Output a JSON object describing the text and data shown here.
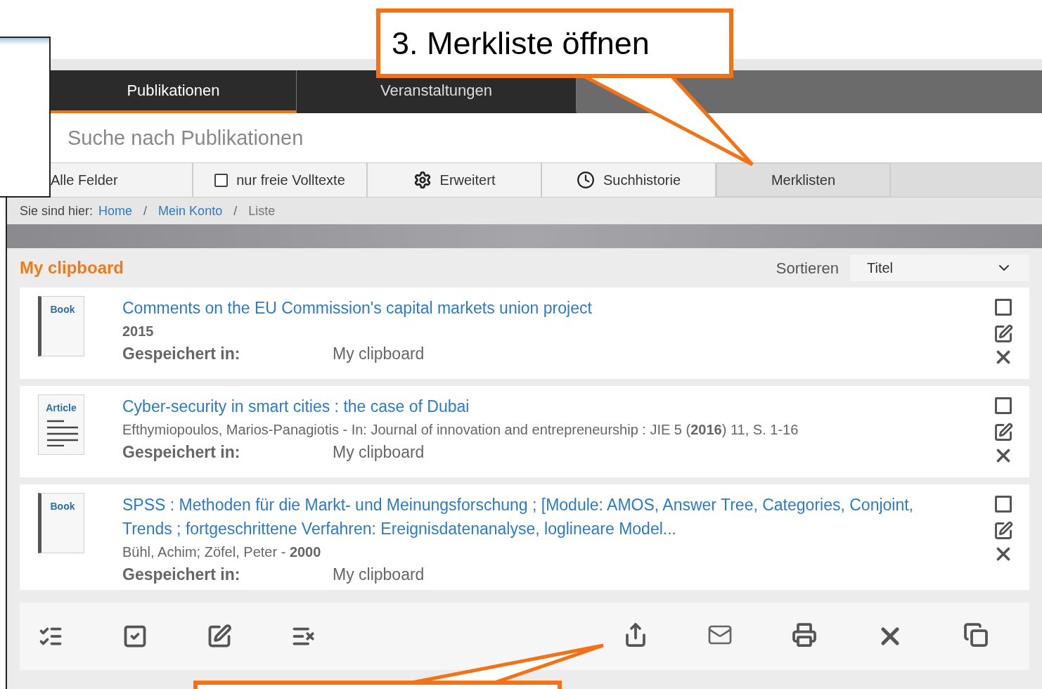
{
  "callouts": [
    {
      "text": "3. Merkliste öffnen"
    }
  ],
  "tabs": [
    {
      "label": "Publikationen",
      "selected": true
    },
    {
      "label": "Veranstaltungen",
      "selected": false
    }
  ],
  "search": {
    "placeholder": "Suche nach Publikationen"
  },
  "search_options": [
    {
      "kind": "select",
      "label": "Alle Felder",
      "selected": false
    },
    {
      "kind": "checkbox",
      "label": "nur freie Volltexte",
      "checked": false,
      "selected": false
    },
    {
      "kind": "gear",
      "label": "Erweitert",
      "selected": false
    },
    {
      "kind": "clock",
      "label": "Suchhistorie",
      "selected": false
    },
    {
      "kind": "plain",
      "label": "Merklisten",
      "selected": true
    }
  ],
  "breadcrumb": {
    "prefix": "Sie sind hier:",
    "items": [
      {
        "label": "Home",
        "kind": "link"
      },
      {
        "label": "Mein Konto",
        "kind": "link"
      },
      {
        "label": "Liste",
        "kind": "current"
      }
    ],
    "separator": "/"
  },
  "list": {
    "title": "My clipboard",
    "sort_label": "Sortieren",
    "sort_value": "Titel"
  },
  "entries": [
    {
      "kind": "book",
      "cover_label": "Book",
      "title": "Comments on the EU Commission's capital markets union project",
      "meta": "**2015**",
      "saved_label": "Gespeichert in:",
      "saved_value": "My clipboard",
      "checked": false
    },
    {
      "kind": "article",
      "cover_label": "Article",
      "title": "Cyber-security in smart cities : the case of Dubai",
      "meta": "Efthymiopoulos, Marios-Panagiotis - In: Journal of innovation and entrepreneurship : JIE 5 (**2016**) 11, S. 1-16",
      "saved_label": "Gespeichert in:",
      "saved_value": "My clipboard",
      "checked": false
    },
    {
      "kind": "book",
      "cover_label": "Book",
      "title": "SPSS : Methoden für die Markt- und Meinungsforschung ; [Module: AMOS, Answer Tree, Categories, Conjoint, Trends ; fortgeschrittene Verfahren: Ereignisdatenanalyse, loglineare Model...",
      "meta": "Bühl, Achim; Zöfel, Peter - **2000**",
      "saved_label": "Gespeichert in:",
      "saved_value": "My clipboard",
      "checked": false
    }
  ]
}
